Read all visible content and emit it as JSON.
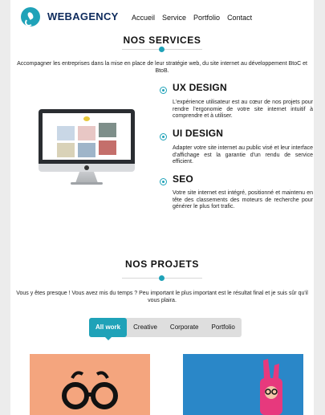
{
  "header": {
    "logo_text": "WEBAGENCY",
    "nav": [
      "Accueil",
      "Service",
      "Portfolio",
      "Contact"
    ]
  },
  "services": {
    "title": "NOS SERVICES",
    "intro": "Accompagner les entreprises dans la mise en place de leur stratégie web, du site internet au développement BtoC et BtoB.",
    "items": [
      {
        "title": "UX DESIGN",
        "text": "L'expérience utilisateur est au cœur de nos projets pour rendre l'ergonomie de votre site internet intuitif à comprendre et à utiliser."
      },
      {
        "title": "UI DESIGN",
        "text": "Adapter votre site internet au public visé et leur interface d'affichage est la garantie d'un rendu de service efficient."
      },
      {
        "title": "SEO",
        "text": "Votre site internet est intégré, positionné et maintenu en tête des classements des moteurs de recherche pour générer le plus fort trafic."
      }
    ]
  },
  "projects": {
    "title": "NOS PROJETS",
    "intro": "Vous y êtes presque ! Vous avez mis du temps ? Peu important le plus important est le résultat final et je suis sûr qu'il vous plaira.",
    "filters": [
      "All work",
      "Creative",
      "Corporate",
      "Portfolio"
    ],
    "active_filter": "All work"
  },
  "colors": {
    "accent": "#1fa2b8",
    "brand_text": "#0d2a5c"
  }
}
